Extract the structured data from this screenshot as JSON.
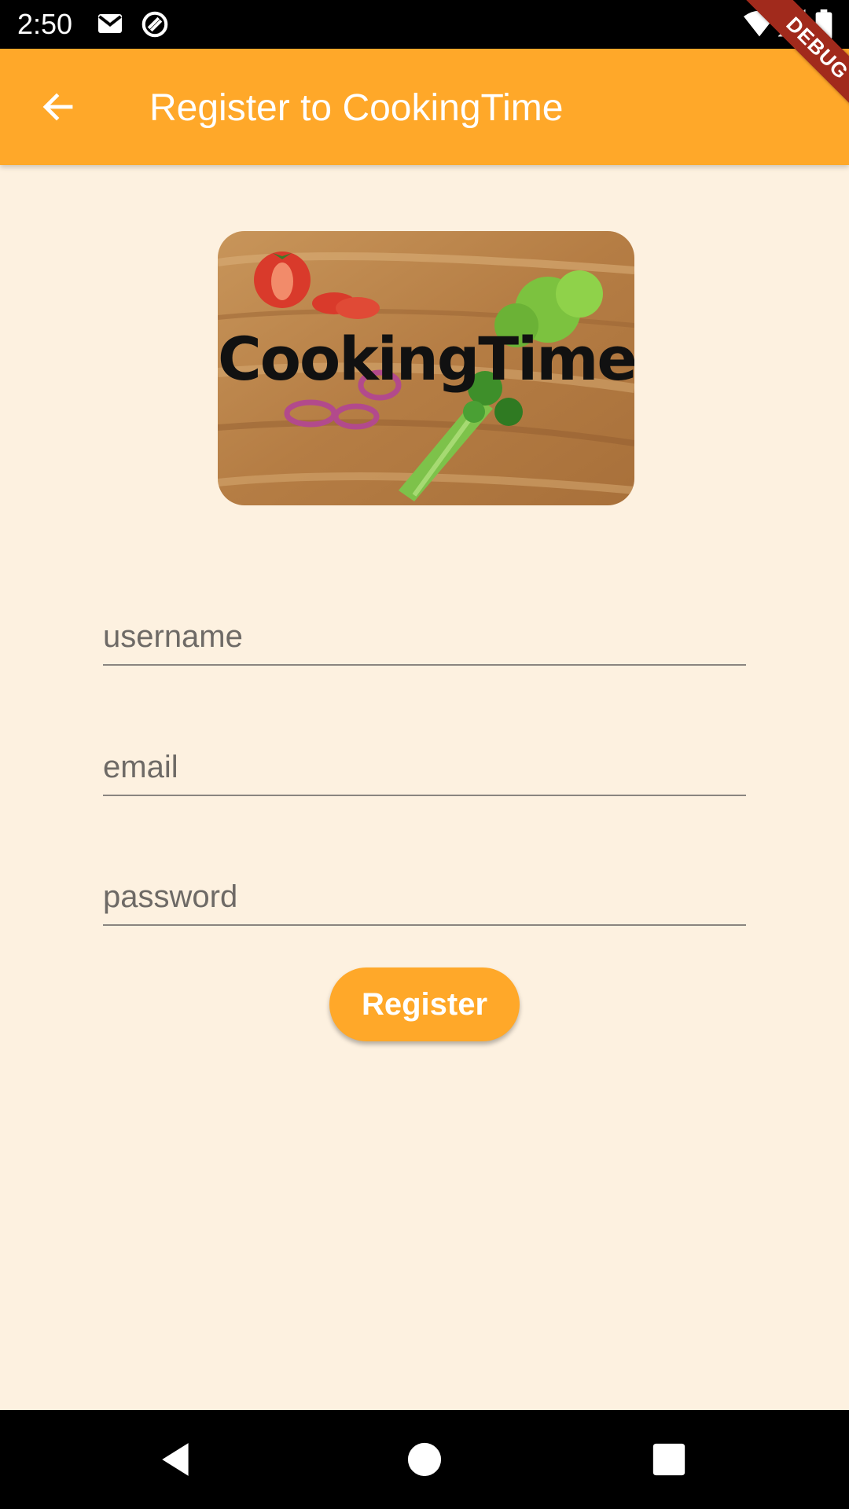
{
  "status_bar": {
    "time": "2:50",
    "icons": [
      "gmail-icon",
      "sync-icon",
      "wifi-icon",
      "signal-icon",
      "battery-icon"
    ]
  },
  "app_bar": {
    "back_icon": "arrow-back-icon",
    "title": "Register to CookingTime",
    "color": "#FFA829"
  },
  "debug_banner": {
    "label": "DEBUG"
  },
  "logo": {
    "text": "CookingTime"
  },
  "form": {
    "username": {
      "value": "",
      "placeholder": "username"
    },
    "email": {
      "value": "",
      "placeholder": "email"
    },
    "password": {
      "value": "",
      "placeholder": "password"
    },
    "register_label": "Register"
  },
  "nav_bar": {
    "icons": [
      "nav-back-icon",
      "nav-home-icon",
      "nav-recents-icon"
    ]
  },
  "colors": {
    "background": "#FDF1E0",
    "accent": "#FFA829"
  }
}
